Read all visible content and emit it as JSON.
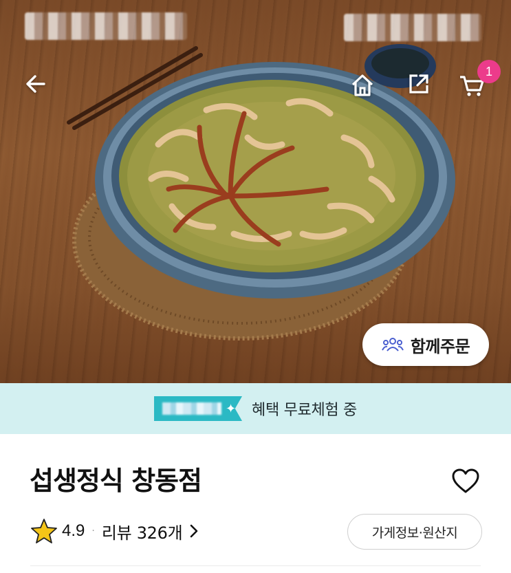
{
  "header": {
    "back_icon": "back-arrow-icon",
    "home_icon": "home-icon",
    "share_icon": "share-icon",
    "cart_icon": "cart-icon",
    "cart_count": "1"
  },
  "hero": {
    "together_order_label": "함께주문",
    "together_icon": "group-icon"
  },
  "banner": {
    "text": "혜택 무료체험 중",
    "background": "#d3f0f1",
    "badge_color": "#2bb9c4"
  },
  "store": {
    "name": "섭생정식 창동점",
    "rating": "4.9",
    "reviews": "리뷰 326개",
    "info_button_label": "가게정보·원산지",
    "favorite_icon": "heart-icon"
  },
  "colors": {
    "accent_pink": "#ec3b8b",
    "star": "#f5c518"
  }
}
